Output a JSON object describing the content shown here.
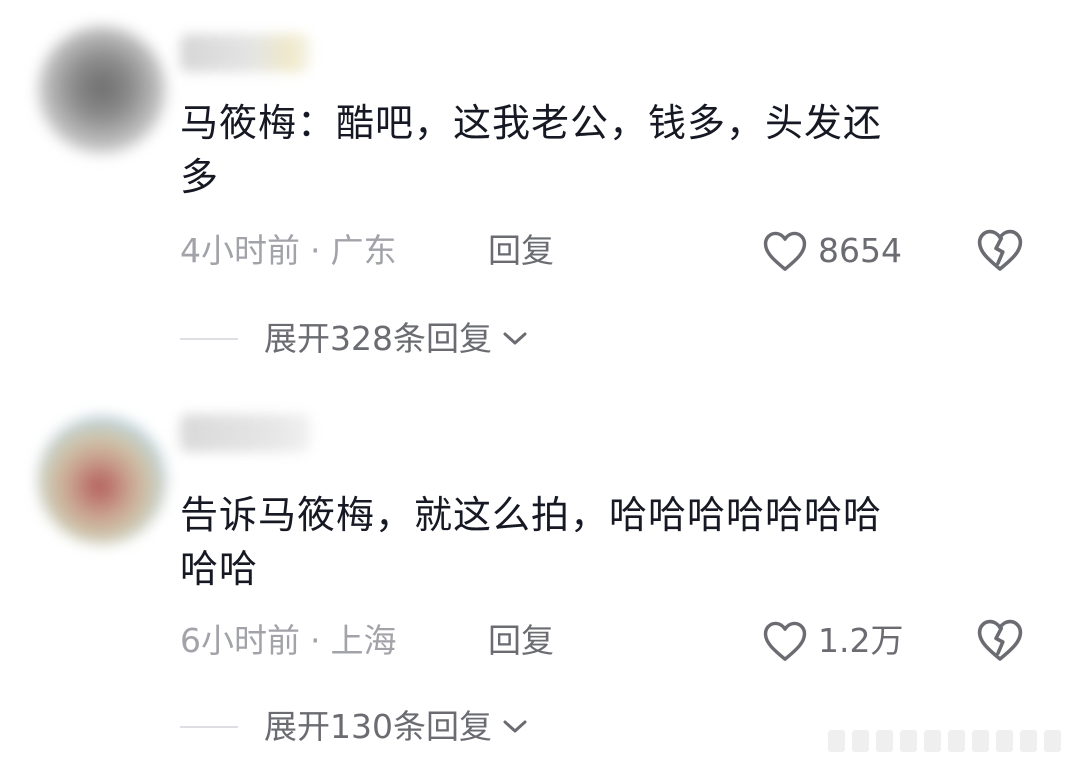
{
  "comments": [
    {
      "text_line1": "马筱梅：酷吧，这我老公，钱多，头发还",
      "text_line2": "多",
      "time": "4小时前",
      "separator": "·",
      "location": "广东",
      "reply_label": "回复",
      "like_count": "8654",
      "expand_label": "展开328条回复"
    },
    {
      "text_line1": "告诉马筱梅，就这么拍，哈哈哈哈哈哈哈",
      "text_line2": "哈哈",
      "time": "6小时前",
      "separator": "·",
      "location": "上海",
      "reply_label": "回复",
      "like_count": "1.2万",
      "expand_label": "展开130条回复"
    }
  ],
  "icons": {
    "like": "heart-outline-icon",
    "dislike": "broken-heart-icon",
    "expand": "chevron-down-icon"
  },
  "colors": {
    "text_primary": "#161823",
    "text_secondary": "#a2a3a8",
    "text_action": "#6b6c72",
    "background": "#ffffff"
  }
}
